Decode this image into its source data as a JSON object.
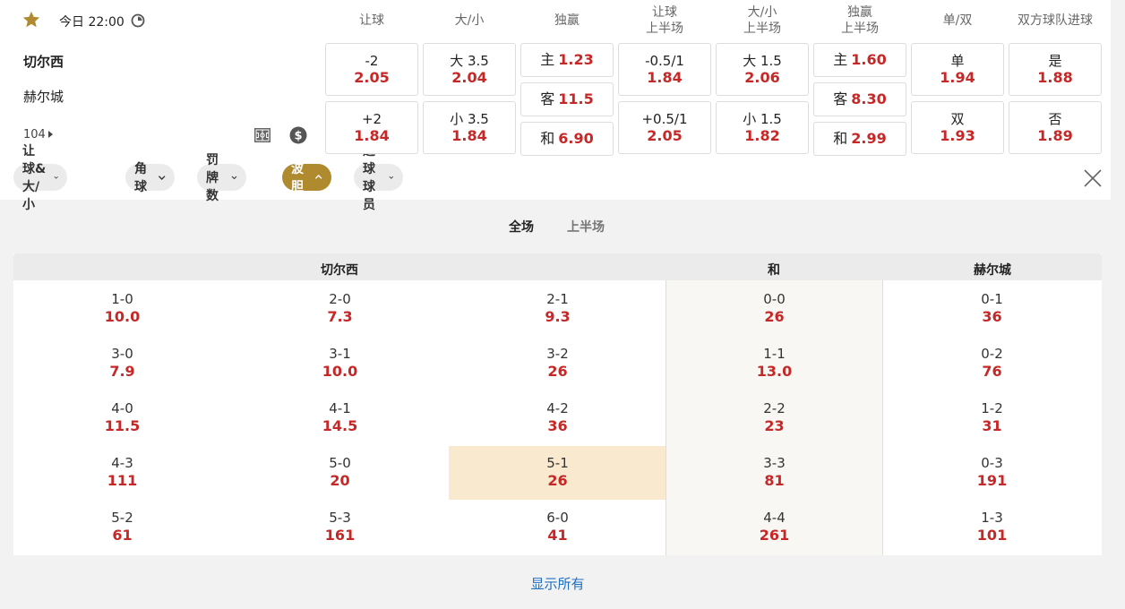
{
  "match": {
    "time": "今日 22:00",
    "home": "切尔西",
    "away": "赫尔城",
    "market_count": "104"
  },
  "columns": [
    {
      "h1": "让球",
      "h2": ""
    },
    {
      "h1": "大/小",
      "h2": ""
    },
    {
      "h1": "独赢",
      "h2": ""
    },
    {
      "h1": "让球",
      "h2": "上半场"
    },
    {
      "h1": "大/小",
      "h2": "上半场"
    },
    {
      "h1": "独赢",
      "h2": "上半场"
    },
    {
      "h1": "单/双",
      "h2": ""
    },
    {
      "h1": "双方球队进球",
      "h2": ""
    }
  ],
  "odds": {
    "handicap": [
      {
        "label": "-2",
        "odd": "2.05"
      },
      {
        "label": "+2",
        "odd": "1.84"
      }
    ],
    "over_under": [
      {
        "label": "大 3.5",
        "odd": "2.04"
      },
      {
        "label": "小 3.5",
        "odd": "1.84"
      }
    ],
    "moneyline": [
      {
        "label": "主",
        "odd": "1.23"
      },
      {
        "label": "客",
        "odd": "11.5"
      },
      {
        "label": "和",
        "odd": "6.90"
      }
    ],
    "handicap_1h": [
      {
        "label": "-0.5/1",
        "odd": "1.84"
      },
      {
        "label": "+0.5/1",
        "odd": "2.05"
      }
    ],
    "over_under_1h": [
      {
        "label": "大 1.5",
        "odd": "2.06"
      },
      {
        "label": "小 1.5",
        "odd": "1.82"
      }
    ],
    "moneyline_1h": [
      {
        "label": "主",
        "odd": "1.60"
      },
      {
        "label": "客",
        "odd": "8.30"
      },
      {
        "label": "和",
        "odd": "2.99"
      }
    ],
    "odd_even": [
      {
        "label": "单",
        "odd": "1.94"
      },
      {
        "label": "双",
        "odd": "1.93"
      }
    ],
    "btts": [
      {
        "label": "是",
        "odd": "1.88"
      },
      {
        "label": "否",
        "odd": "1.89"
      }
    ]
  },
  "filters": [
    {
      "label": "让球&大/小",
      "active": false
    },
    {
      "label": "角球",
      "active": false
    },
    {
      "label": "罚牌数",
      "active": false
    },
    {
      "label": "波胆",
      "active": true
    },
    {
      "label": "进球球员",
      "active": false
    }
  ],
  "tabs": [
    "全场",
    "上半场"
  ],
  "board": {
    "headers": {
      "home": "切尔西",
      "draw": "和",
      "away": "赫尔城"
    },
    "home_scores": [
      [
        {
          "s": "1-0",
          "o": "10.0"
        },
        {
          "s": "2-0",
          "o": "7.3"
        },
        {
          "s": "2-1",
          "o": "9.3"
        }
      ],
      [
        {
          "s": "3-0",
          "o": "7.9"
        },
        {
          "s": "3-1",
          "o": "10.0"
        },
        {
          "s": "3-2",
          "o": "26"
        }
      ],
      [
        {
          "s": "4-0",
          "o": "11.5"
        },
        {
          "s": "4-1",
          "o": "14.5"
        },
        {
          "s": "4-2",
          "o": "36"
        }
      ],
      [
        {
          "s": "4-3",
          "o": "111"
        },
        {
          "s": "5-0",
          "o": "20"
        },
        {
          "s": "5-1",
          "o": "26"
        }
      ],
      [
        {
          "s": "5-2",
          "o": "61"
        },
        {
          "s": "5-3",
          "o": "161"
        },
        {
          "s": "6-0",
          "o": "41"
        }
      ]
    ],
    "draw_scores": [
      {
        "s": "0-0",
        "o": "26"
      },
      {
        "s": "1-1",
        "o": "13.0"
      },
      {
        "s": "2-2",
        "o": "23"
      },
      {
        "s": "3-3",
        "o": "81"
      },
      {
        "s": "4-4",
        "o": "261"
      }
    ],
    "away_scores": [
      {
        "s": "0-1",
        "o": "36"
      },
      {
        "s": "0-2",
        "o": "76"
      },
      {
        "s": "1-2",
        "o": "31"
      },
      {
        "s": "0-3",
        "o": "191"
      },
      {
        "s": "1-3",
        "o": "101"
      }
    ]
  },
  "show_all": "显示所有",
  "colors": {
    "accent": "#b08a2e",
    "odds": "#c62828",
    "link": "#1e6fc1",
    "highlight": "#f8e9cf"
  }
}
